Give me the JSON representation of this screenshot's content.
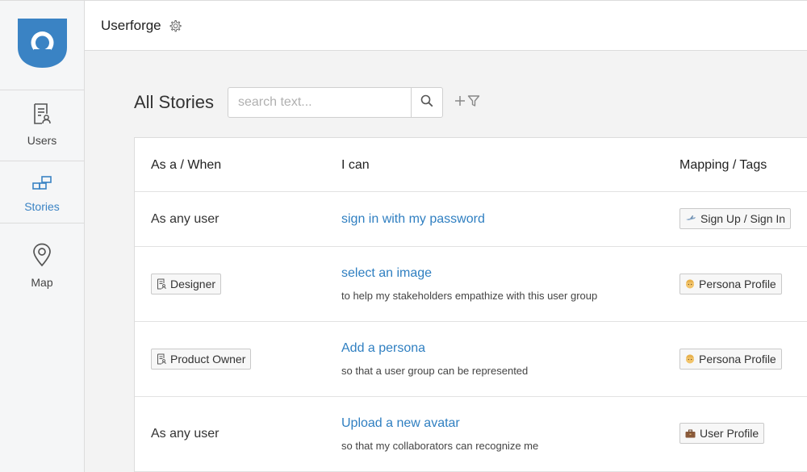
{
  "app": {
    "title": "Userforge"
  },
  "sidebar": {
    "items": [
      {
        "label": "Users",
        "icon": "user-document-icon",
        "active": false
      },
      {
        "label": "Stories",
        "icon": "stories-blocks-icon",
        "active": true
      },
      {
        "label": "Map",
        "icon": "map-pin-icon",
        "active": false
      }
    ]
  },
  "main": {
    "heading": "All Stories",
    "search": {
      "placeholder": "search text...",
      "value": ""
    },
    "table": {
      "headers": [
        "As a / When",
        "I can",
        "Mapping / Tags"
      ],
      "rows": [
        {
          "actor": "As any user",
          "actor_chip": false,
          "story": "sign in with my password",
          "benefit": "",
          "tag": "Sign Up / Sign In",
          "tag_icon": "airplane-emoji"
        },
        {
          "actor": "Designer",
          "actor_chip": true,
          "story": "select an image",
          "benefit": "to help my stakeholders empathize with this user group",
          "tag": "Persona Profile",
          "tag_icon": "face-emoji"
        },
        {
          "actor": "Product Owner",
          "actor_chip": true,
          "story": "Add a persona",
          "benefit": "so that a user group can be represented",
          "tag": "Persona Profile",
          "tag_icon": "face-emoji"
        },
        {
          "actor": "As any user",
          "actor_chip": false,
          "story": "Upload a new avatar",
          "benefit": "so that my collaborators can recognize me",
          "tag": "User Profile",
          "tag_icon": "briefcase-emoji"
        }
      ]
    }
  },
  "colors": {
    "accent": "#3a83c4",
    "link": "#2f7fc1"
  }
}
